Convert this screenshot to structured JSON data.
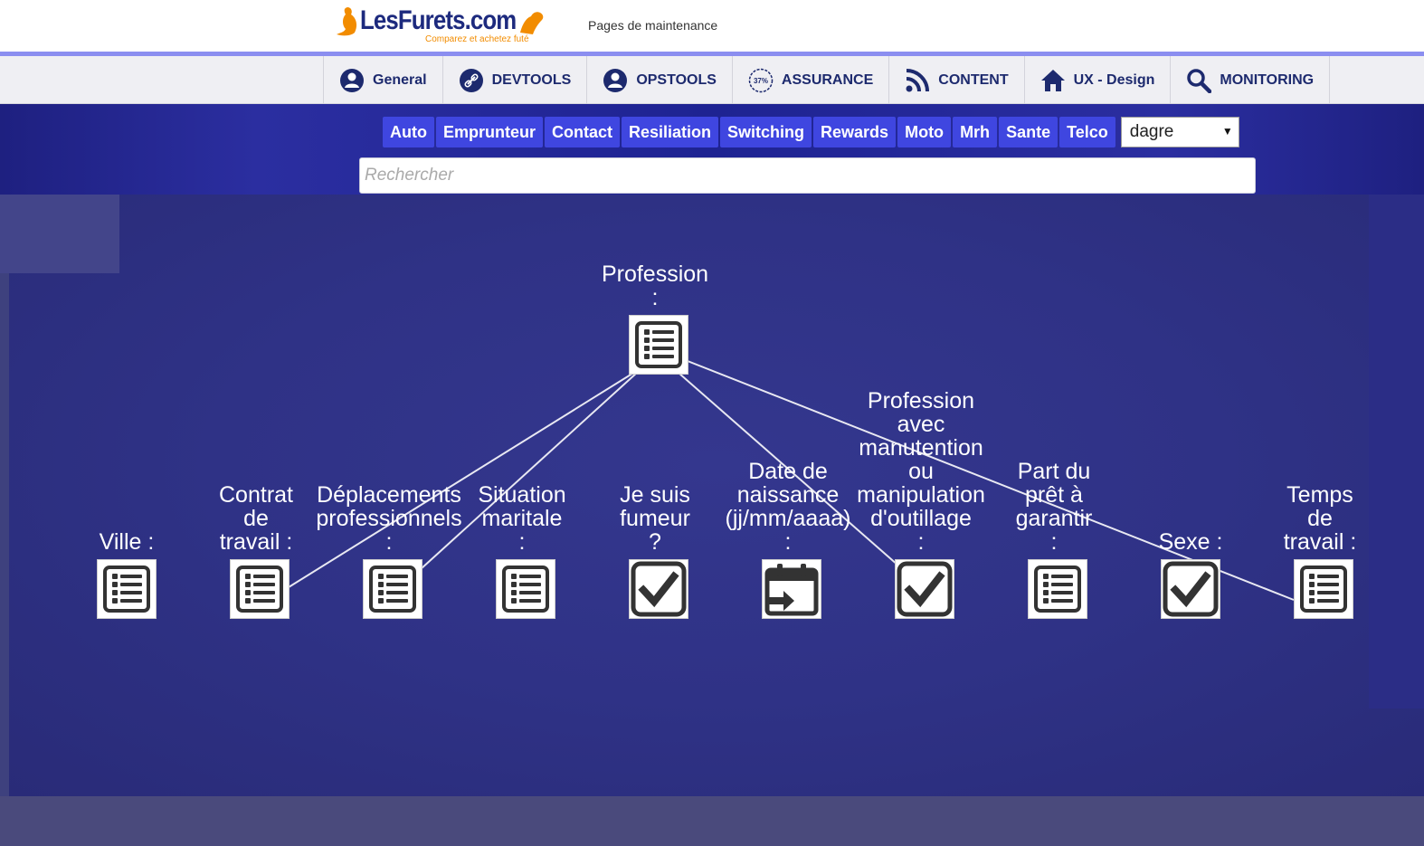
{
  "header": {
    "logo_text": "LesFurets.com",
    "logo_tagline": "Comparez et achetez futé",
    "title": "Pages de maintenance"
  },
  "colors": {
    "brand_dark_blue": "#1d2a6e",
    "brand_orange": "#f28c00",
    "tab_blue": "#3f46e0",
    "band_blue": "#2b2ea0",
    "canvas_blue": "#2f3286"
  },
  "nav": {
    "items": [
      {
        "label": "General",
        "icon": "user-icon"
      },
      {
        "label": "DEVTOOLS",
        "icon": "link-icon"
      },
      {
        "label": "OPSTOOLS",
        "icon": "user-icon"
      },
      {
        "label": "ASSURANCE",
        "icon": "percent-badge-icon"
      },
      {
        "label": "CONTENT",
        "icon": "rss-icon"
      },
      {
        "label": "UX - Design",
        "icon": "home-icon"
      },
      {
        "label": "MONITORING",
        "icon": "search-icon"
      }
    ]
  },
  "subnav": {
    "tabs": [
      "Auto",
      "Emprunteur",
      "Contact",
      "Resiliation",
      "Switching",
      "Rewards",
      "Moto",
      "Mrh",
      "Sante",
      "Telco"
    ],
    "select_value": "dagre"
  },
  "search": {
    "placeholder": "Rechercher"
  },
  "graph": {
    "root": {
      "label": "Profession\n:",
      "icon": "list-icon"
    },
    "children": [
      {
        "label": "Ville :",
        "icon": "list-icon"
      },
      {
        "label": "Contrat\nde\ntravail :",
        "icon": "list-icon"
      },
      {
        "label": "Déplacements\nprofessionnels\n:",
        "icon": "list-icon"
      },
      {
        "label": "Situation\nmaritale\n:",
        "icon": "list-icon"
      },
      {
        "label": "Je suis\nfumeur\n?",
        "icon": "checkbox-icon"
      },
      {
        "label": "Date de\nnaissance\n(jj/mm/aaaa)\n:",
        "icon": "calendar-icon"
      },
      {
        "label": "Profession\navec\nmanutention\nou\nmanipulation\nd'outillage\n:",
        "icon": "checkbox-icon"
      },
      {
        "label": "Part du\nprêt à\ngarantir\n:",
        "icon": "list-icon"
      },
      {
        "label": "Sexe :",
        "icon": "checkbox-icon"
      },
      {
        "label": "Temps\nde\ntravail :",
        "icon": "list-icon"
      }
    ]
  }
}
